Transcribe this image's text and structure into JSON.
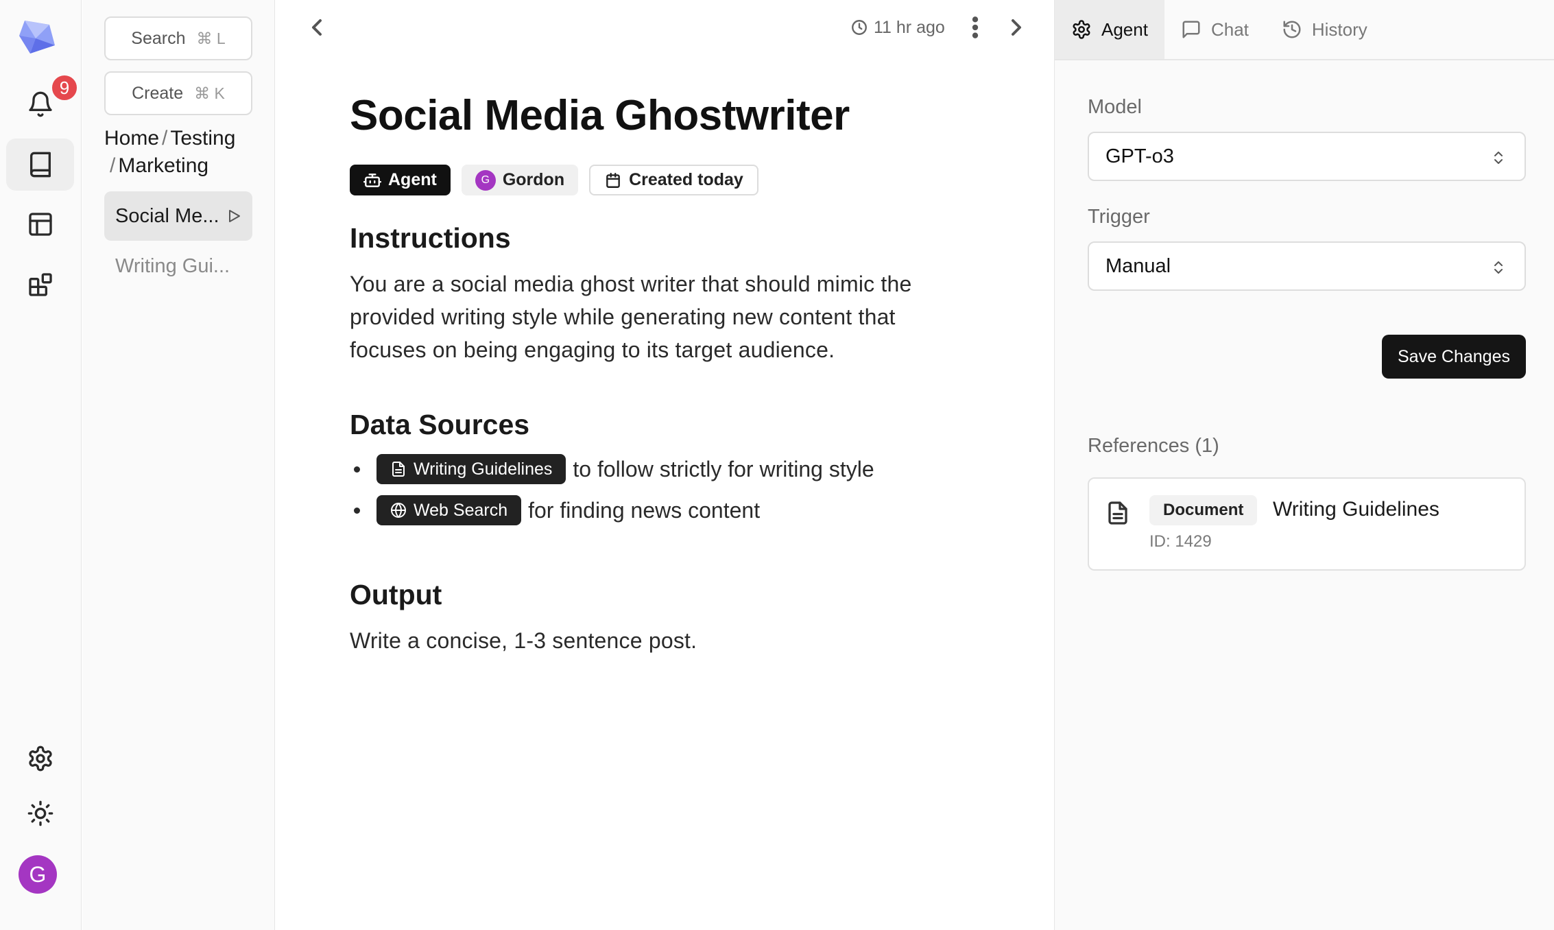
{
  "rail": {
    "notifications_count": "9",
    "avatar_initial": "G",
    "brand_color": "#6b7bf0",
    "avatar_color": "#a436c2",
    "badge_color": "#e5484d"
  },
  "tree": {
    "search_label": "Search",
    "search_shortcut": "⌘ L",
    "create_label": "Create",
    "create_shortcut": "⌘ K",
    "breadcrumb": [
      "Home",
      "Testing",
      "Marketing"
    ],
    "items": [
      {
        "label": "Social Me...",
        "active": true
      },
      {
        "label": "Writing Gui...",
        "active": false
      }
    ]
  },
  "document": {
    "updated": "11 hr ago",
    "title": "Social Media Ghostwriter",
    "chips": {
      "type": "Agent",
      "author_initial": "G",
      "author": "Gordon",
      "created": "Created today"
    },
    "instructions_heading": "Instructions",
    "instructions_text": "You are a social media ghost writer that should mimic the provided writing style while generating new content that focuses on being engaging to its target audience.",
    "data_sources_heading": "Data Sources",
    "data_sources": [
      {
        "pill": "Writing Guidelines",
        "icon": "document-icon",
        "text": "to follow strictly for writing style"
      },
      {
        "pill": "Web Search",
        "icon": "globe-icon",
        "text": "for finding news content"
      }
    ],
    "output_heading": "Output",
    "output_text": "Write a concise, 1-3 sentence post."
  },
  "panel": {
    "tabs": [
      {
        "label": "Agent",
        "icon": "gear-icon",
        "active": true
      },
      {
        "label": "Chat",
        "icon": "chat-icon",
        "active": false
      },
      {
        "label": "History",
        "icon": "history-icon",
        "active": false
      }
    ],
    "model_label": "Model",
    "model_value": "GPT-o3",
    "trigger_label": "Trigger",
    "trigger_value": "Manual",
    "save_label": "Save Changes",
    "references_label": "References (1)",
    "reference": {
      "tag": "Document",
      "title": "Writing Guidelines",
      "id": "ID: 1429"
    }
  }
}
